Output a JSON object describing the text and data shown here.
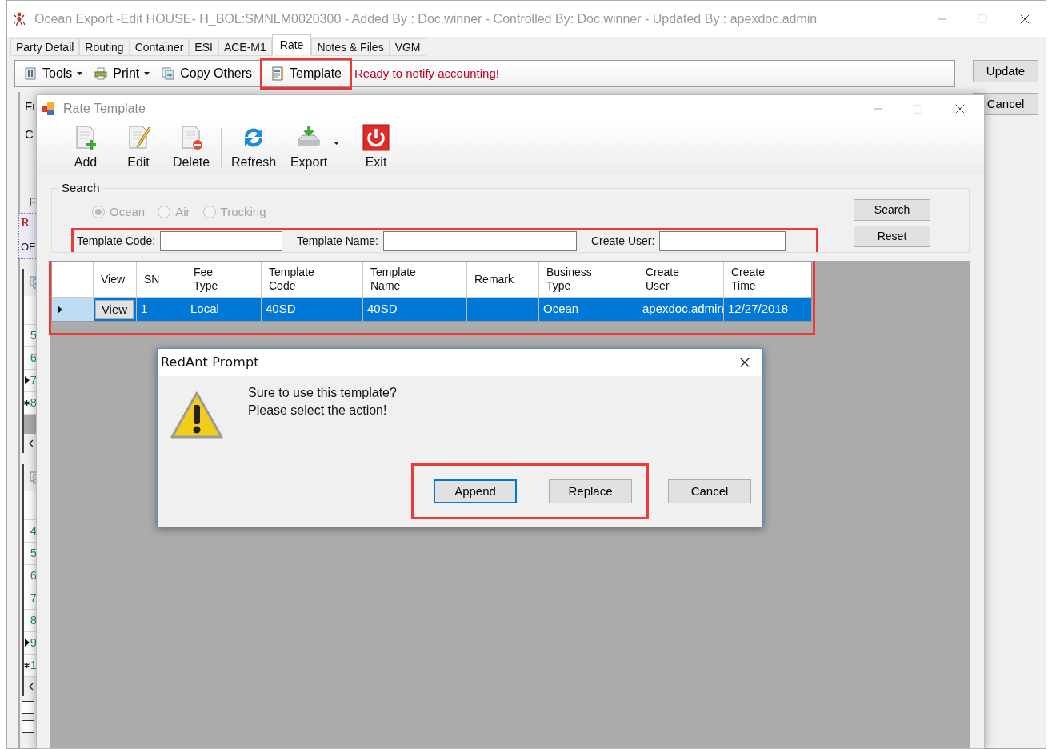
{
  "main_window": {
    "title": "Ocean Export -Edit HOUSE- H_BOL:SMNLM0020300 - Added By : Doc.winner - Controlled By: Doc.winner - Updated By : apexdoc.admin",
    "tabs": [
      {
        "label": "Party Detail",
        "selected": false
      },
      {
        "label": "Routing",
        "selected": false
      },
      {
        "label": "Container",
        "selected": false
      },
      {
        "label": "ESI",
        "selected": false
      },
      {
        "label": "ACE-M1",
        "selected": false
      },
      {
        "label": "Rate",
        "selected": true
      },
      {
        "label": "Notes & Files",
        "selected": false
      },
      {
        "label": "VGM",
        "selected": false
      }
    ],
    "toolbar": [
      {
        "kind": "dropdown",
        "label": "Tools",
        "highlighted": false
      },
      {
        "kind": "dropdown",
        "label": "Print",
        "highlighted": false
      },
      {
        "kind": "button",
        "label": "Copy Others",
        "highlighted": false
      },
      {
        "kind": "button",
        "label": "Template",
        "highlighted": true
      }
    ],
    "status_message": "Ready to notify accounting!",
    "buttons": [
      "Update",
      "Cancel"
    ],
    "background_fragments": {
      "labels": [
        "Fi",
        "C",
        "F",
        "R",
        "OE"
      ],
      "grids": [
        {
          "rows": [
            {
              "text": "5",
              "current": false,
              "new": false
            },
            {
              "text": "6",
              "current": false,
              "new": false
            },
            {
              "text": "7",
              "current": true,
              "new": false
            },
            {
              "text": "8",
              "current": false,
              "new": true
            }
          ]
        },
        {
          "rows": [
            {
              "text": "4",
              "current": false,
              "new": false
            },
            {
              "text": "5",
              "current": false,
              "new": false
            },
            {
              "text": "6",
              "current": false,
              "new": false
            },
            {
              "text": "7",
              "current": false,
              "new": false
            },
            {
              "text": "8",
              "current": false,
              "new": false
            },
            {
              "text": "9",
              "current": true,
              "new": false
            },
            {
              "text": "1",
              "current": false,
              "new": true
            }
          ]
        }
      ],
      "checkboxes": [
        {
          "checked": false
        },
        {
          "checked": false
        }
      ]
    }
  },
  "rate_template": {
    "title": "Rate Template",
    "toolbar": [
      {
        "kind": "button",
        "label": "Add"
      },
      {
        "kind": "button",
        "label": "Edit"
      },
      {
        "kind": "button",
        "label": "Delete"
      },
      {
        "kind": "separator"
      },
      {
        "kind": "button",
        "label": "Refresh"
      },
      {
        "kind": "dropdown",
        "label": "Export"
      },
      {
        "kind": "separator"
      },
      {
        "kind": "button",
        "label": "Exit"
      }
    ],
    "search": {
      "legend": "Search",
      "modes": [
        {
          "label": "Ocean",
          "selected": true,
          "disabled": true
        },
        {
          "label": "Air",
          "selected": false,
          "disabled": true
        },
        {
          "label": "Trucking",
          "selected": false,
          "disabled": true
        }
      ],
      "fields": [
        {
          "label": "Template Code:"
        },
        {
          "label": "Template Name:"
        },
        {
          "label": "Create User:"
        }
      ],
      "buttons": [
        "Search",
        "Reset"
      ],
      "highlighted": true
    },
    "table": {
      "columns": [
        "View",
        "SN",
        "Fee Type",
        "Template Code",
        "Template Name",
        "Remark",
        "Business Type",
        "Create User",
        "Create Time"
      ],
      "rows": [
        {
          "selected": true,
          "current": true,
          "cells": [
            "View",
            "1",
            "Local",
            "40SD",
            "40SD",
            null,
            "Ocean",
            "apexdoc.admin",
            "12/27/2018"
          ]
        }
      ]
    }
  },
  "prompt": {
    "title": "RedAnt Prompt",
    "message": [
      "Sure to use this template?",
      "Please select the action!"
    ],
    "buttons": [
      {
        "label": "Append",
        "focused": true,
        "highlighted": true
      },
      {
        "label": "Replace",
        "focused": false,
        "highlighted": true
      },
      {
        "label": "Cancel",
        "focused": false,
        "highlighted": false
      }
    ]
  }
}
